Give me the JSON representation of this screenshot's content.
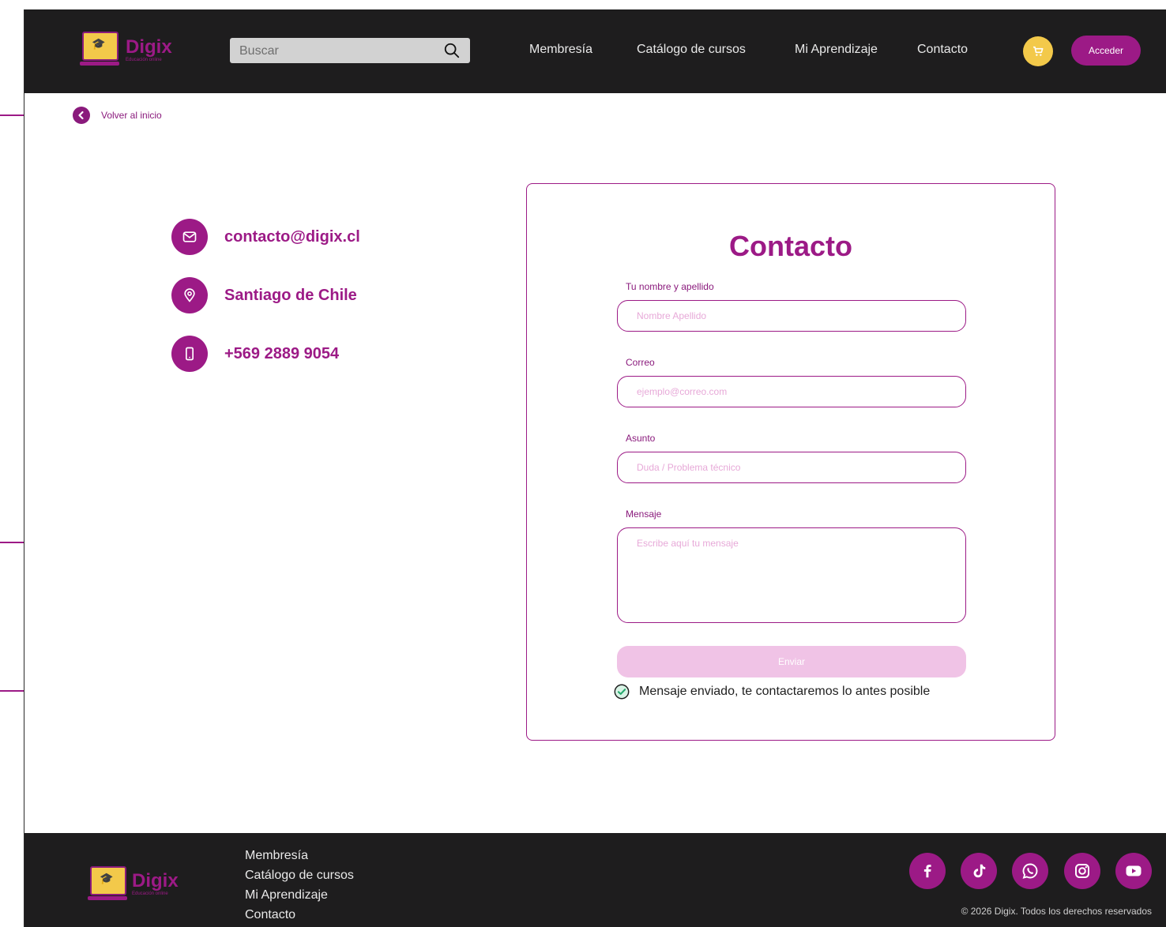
{
  "header": {
    "brand_name": "Digix",
    "brand_tagline": "Educación online",
    "search_placeholder": "Buscar",
    "nav": [
      "Membresía",
      "Catálogo de cursos",
      "Mi Aprendizaje",
      "Contacto"
    ],
    "login_label": "Acceder"
  },
  "back_link": {
    "label": "Volver al inicio"
  },
  "contact_info": {
    "email": "contacto@digix.cl",
    "location": "Santiago de Chile",
    "phone": "+569 2889 9054"
  },
  "form": {
    "title": "Contacto",
    "fields": [
      {
        "label": "Tu nombre y apellido",
        "placeholder": "Nombre Apellido",
        "value": ""
      },
      {
        "label": "Correo",
        "placeholder": "ejemplo@correo.com",
        "value": ""
      },
      {
        "label": "Asunto",
        "placeholder": "Duda / Problema técnico",
        "value": ""
      },
      {
        "label": "Mensaje",
        "placeholder": "Escribe aquí tu mensaje",
        "value": ""
      }
    ],
    "submit_label": "Enviar",
    "success_message": "Mensaje enviado, te contactaremos lo antes posible"
  },
  "footer": {
    "brand_name": "Digix",
    "brand_tagline": "Educación online",
    "links": [
      "Membresía",
      "Catálogo de cursos",
      "Mi Aprendizaje",
      "Contacto"
    ],
    "social": [
      "facebook-icon",
      "tiktok-icon",
      "whatsapp-icon",
      "instagram-icon",
      "youtube-icon"
    ],
    "copyright": "© 2026 Digix. Todos los derechos reservados"
  },
  "colors": {
    "brand": "#9c1a86",
    "accent_yellow": "#f3c94a",
    "dark_bar": "#1e1d1e",
    "disabled_button": "#f0c3e6",
    "success_green": "#23a86b"
  }
}
